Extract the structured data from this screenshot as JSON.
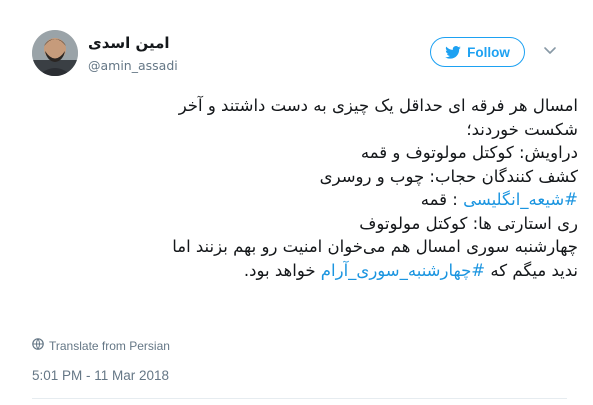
{
  "user": {
    "name": "امین اسدی",
    "handle": "@amin_assadi"
  },
  "follow_button": {
    "label": "Follow"
  },
  "tweet": {
    "line1": "امسال هر فرقه ای حداقل یک چیزی به دست داشتند و آخر",
    "line2": "شکست خوردند؛",
    "line3": "دراویش: کوکتل مولوتوف و قمه",
    "line4": "کشف کنندگان حجاب: چوب و روسری",
    "line5_hashtag": "#شیعه_انگلیسی",
    "line5_rest": " : قمه",
    "line6": "ری استارتی ها: کوکتل مولوتوف",
    "line7": "چهارشنبه سوری امسال هم می‌خوان امنیت رو بهم بزنند اما",
    "line8_start": "ندید میگم که ",
    "line8_hashtag": "#چهارشنبه_سوری_آرام",
    "line8_end": " خواهد بود."
  },
  "translate_label": "Translate from Persian",
  "timestamp": "5:01 PM - 11 Mar 2018",
  "colors": {
    "accent": "#1da1f2",
    "hashtag": "#1b95e0",
    "secondary_text": "#657786"
  },
  "icons": {
    "follow": "twitter-bird-icon",
    "menu": "chevron-down-icon",
    "translate": "globe-icon"
  }
}
